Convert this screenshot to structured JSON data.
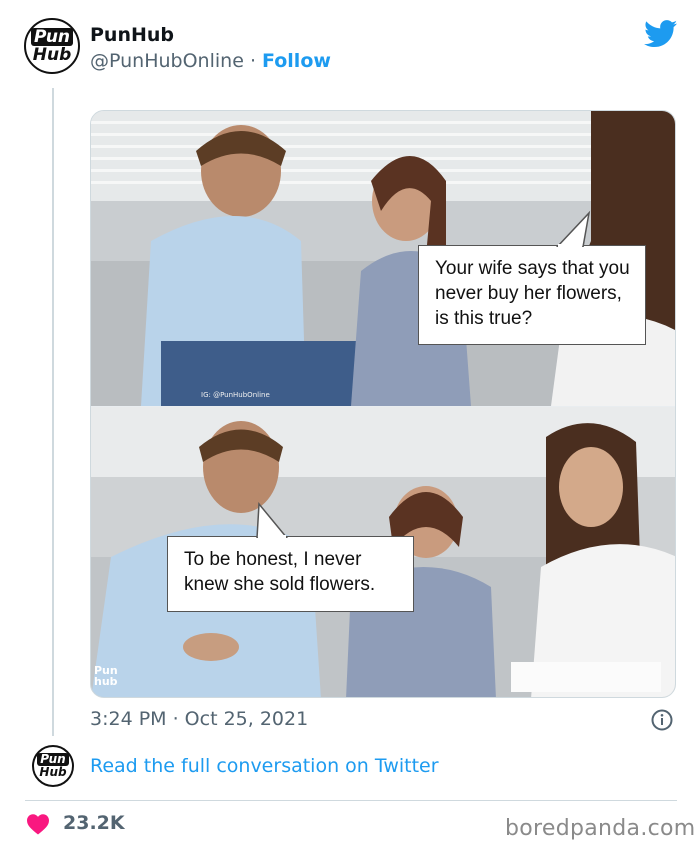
{
  "tweet": {
    "author_name": "PunHub",
    "author_handle": "@PunHubOnline",
    "separator": "·",
    "follow_label": "Follow",
    "avatar_line1": "Pun",
    "avatar_line2": "Hub",
    "timestamp": "3:24 PM · Oct 25, 2021",
    "read_more_label": "Read the full conversation on Twitter",
    "likes_count": "23.2K"
  },
  "meme": {
    "top_speech": "Your wife says that you never buy her flowers, is this true?",
    "bottom_speech": "To be honest, I never knew she sold flowers.",
    "small_watermark": "IG: @PunHubOnline",
    "corner_watermark_line1": "Pun",
    "corner_watermark_line2": "hub"
  },
  "footer": {
    "brand": "boredpanda.com"
  },
  "icons": {
    "logo": "twitter-bird-icon",
    "info": "info-icon",
    "like": "heart-icon"
  },
  "colors": {
    "twitter_blue": "#1d9bf0",
    "heart_red": "#f91880",
    "muted_text": "#536471"
  }
}
